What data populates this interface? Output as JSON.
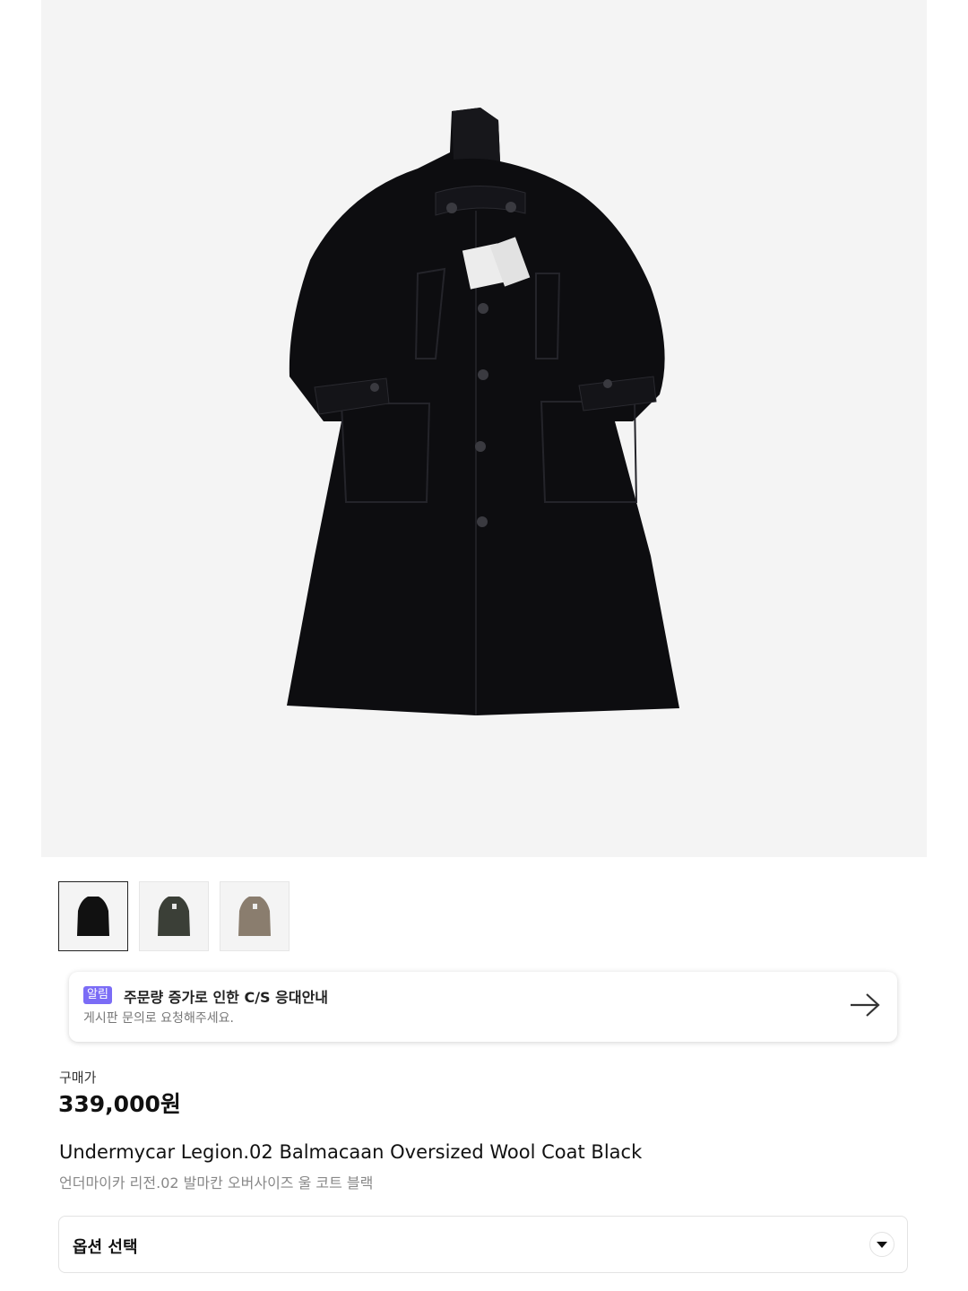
{
  "product_image": {
    "alt_icon": "coat-image",
    "background": "#f4f4f4"
  },
  "thumbnails": [
    {
      "color": "#111111",
      "active": true
    },
    {
      "color": "#3b3f37",
      "active": false
    },
    {
      "color": "#8a7d6e",
      "active": false
    }
  ],
  "notice": {
    "badge": "알림",
    "title": "주문량 증가로 인한 C/S 응대안내",
    "subtitle": "게시판 문의로 요청해주세요.",
    "arrow_icon": "arrow-right-icon",
    "badge_color": "#7b6cf6"
  },
  "price": {
    "label": "구매가",
    "value": "339,000원"
  },
  "product": {
    "title_en": "Undermycar Legion.02 Balmacaan Oversized Wool Coat Black",
    "title_ko": "언더마이카 리전.02 발마칸 오버사이즈 울 코트 블랙"
  },
  "option_select": {
    "label": "옵션 선택",
    "icon": "chevron-down-icon"
  }
}
